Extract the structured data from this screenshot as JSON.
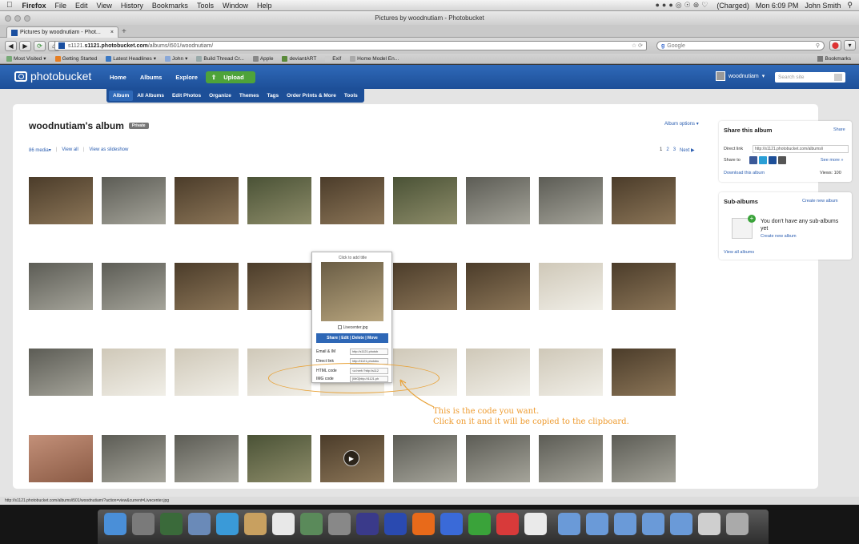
{
  "menubar": {
    "app": "Firefox",
    "items": [
      "File",
      "Edit",
      "View",
      "History",
      "Bookmarks",
      "Tools",
      "Window",
      "Help"
    ],
    "battery": "(Charged)",
    "clock": "Mon 6:09 PM",
    "user": "John Smith"
  },
  "window": {
    "title": "Pictures by woodnutiam - Photobucket",
    "tab_label": "Pictures by woodnutiam - Phot..."
  },
  "browser": {
    "url_domain": "s1121.photobucket.com",
    "url_path": "/albums/i501/woodnutiam/",
    "search_placeholder": "Google",
    "bookmarks": [
      "Most Visited",
      "Getting Started",
      "Latest Headlines",
      "John",
      "Build Thread Cr...",
      "Apple",
      "deviantART",
      "Exif",
      "Home Model En..."
    ],
    "bookmarks_right": "Bookmarks"
  },
  "pb_nav": {
    "logo": "photobucket",
    "items": [
      "Home",
      "Albums",
      "Explore"
    ],
    "upload": "Upload",
    "username": "woodnutiam",
    "search_placeholder": "Search site"
  },
  "subnav": {
    "items": [
      "Album",
      "All Albums",
      "Edit Photos",
      "Organize",
      "Themes",
      "Tags",
      "Order Prints & More",
      "Tools"
    ]
  },
  "album": {
    "title": "woodnutiam's album",
    "privacy": "Private",
    "options": "Album options",
    "media_count": "86 media",
    "view_all": "View all",
    "slideshow": "View as slideshow",
    "pages": [
      "1",
      "2",
      "3"
    ],
    "next": "Next"
  },
  "thumbs": [
    {
      "tone": "dark"
    },
    {
      "tone": "metal"
    },
    {
      "tone": "dark"
    },
    {
      "tone": "green"
    },
    {
      "tone": "dark"
    },
    {
      "tone": "green"
    },
    {
      "tone": "metal"
    },
    {
      "tone": "metal"
    },
    {
      "tone": "dark"
    },
    {
      "tone": "metal"
    },
    {
      "tone": "metal"
    },
    {
      "tone": "dark"
    },
    {
      "tone": "dark"
    },
    {
      "tone": "dark"
    },
    {
      "tone": "dark"
    },
    {
      "tone": "dark"
    },
    {
      "tone": "white"
    },
    {
      "tone": "dark"
    },
    {
      "tone": "metal"
    },
    {
      "tone": "white"
    },
    {
      "tone": "white"
    },
    {
      "tone": "white"
    },
    {
      "tone": "white"
    },
    {
      "tone": "white"
    },
    {
      "tone": "white"
    },
    {
      "tone": "white"
    },
    {
      "tone": "dark"
    },
    {
      "tone": "face"
    },
    {
      "tone": "metal"
    },
    {
      "tone": "metal"
    },
    {
      "tone": "green"
    },
    {
      "tone": "dark",
      "video": true
    },
    {
      "tone": "metal"
    },
    {
      "tone": "metal"
    },
    {
      "tone": "metal"
    },
    {
      "tone": "metal"
    }
  ],
  "popup": {
    "title": "Click to add title",
    "filename": "Livecenter.jpg",
    "actions": "Share | Edit | Delete | Move",
    "links": [
      {
        "label": "Email & IM",
        "value": "http://s1121.photob"
      },
      {
        "label": "Direct link",
        "value": "http://i1121.photobu"
      },
      {
        "label": "HTML code",
        "value": "<a href=\"http://s112"
      },
      {
        "label": "IMG code",
        "value": "[IMG]http://i1121.ph"
      }
    ]
  },
  "annotation": {
    "line1": "This is the code you want.",
    "line2": "Click on it and it will be copied to the clipboard."
  },
  "share_box": {
    "title": "Share this album",
    "share_link": "Share",
    "direct_label": "Direct link",
    "direct_value": "http://s1121.photobucket.com/albums/i",
    "share_to": "Share to",
    "see_more": "See more",
    "download": "Download this album",
    "views": "Views: 100"
  },
  "sub_albums": {
    "title": "Sub-albums",
    "create": "Create new album",
    "empty_text": "You don't have any sub-albums yet",
    "create_link": "Create new album",
    "view_all": "View all albums"
  },
  "statusbar": {
    "url": "http://s1121.photobucket.com/albums/i501/woodnutiam/?action=view&current=Livecenter.jpg"
  },
  "colors": {
    "pb_blue": "#1d4f98",
    "upload_green": "#4ea33a",
    "link_blue": "#2a5db0",
    "annotation_orange": "#ee9b2f"
  }
}
